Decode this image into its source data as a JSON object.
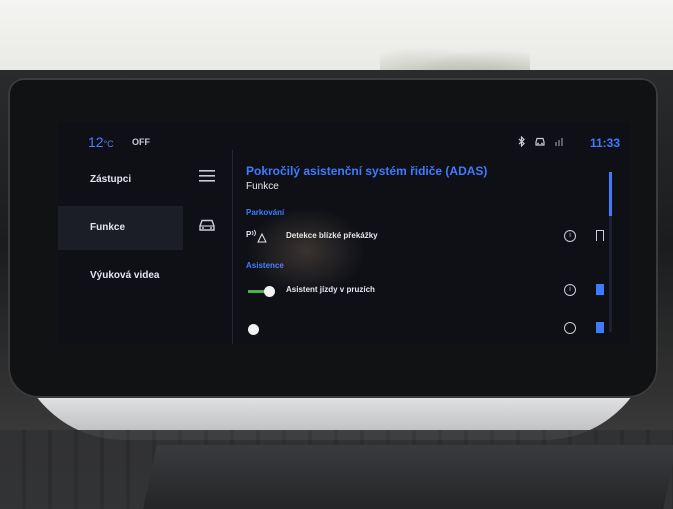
{
  "status": {
    "temperature": "12",
    "temperature_unit": "°C",
    "ac_state": "OFF",
    "time": "11:33",
    "icons": [
      "bluetooth-icon",
      "car-connected-icon",
      "signal-icon"
    ]
  },
  "sidebar": {
    "items": [
      {
        "label": "Zástupci",
        "icon": "menu-icon",
        "active": false
      },
      {
        "label": "Funkce",
        "icon": "car-icon",
        "active": true
      },
      {
        "label": "Výuková videa",
        "icon": "",
        "active": false
      }
    ]
  },
  "main": {
    "title": "Pokročilý asistenční systém řidiče (ADAS)",
    "subtitle": "Funkce",
    "sections": [
      {
        "heading": "Parkování",
        "rows": [
          {
            "icon": "obstacle-sensor-icon",
            "label": "Detekce blízké překážky",
            "bookmarked": false
          }
        ]
      },
      {
        "heading": "Asistence",
        "rows": [
          {
            "icon": "toggle-on",
            "label": "Asistent jízdy v pruzích",
            "bookmarked": true
          }
        ]
      }
    ]
  },
  "colors": {
    "accent": "#3f7bff",
    "screen_bg": "#0e1016",
    "toggle_on": "#4caf50"
  }
}
